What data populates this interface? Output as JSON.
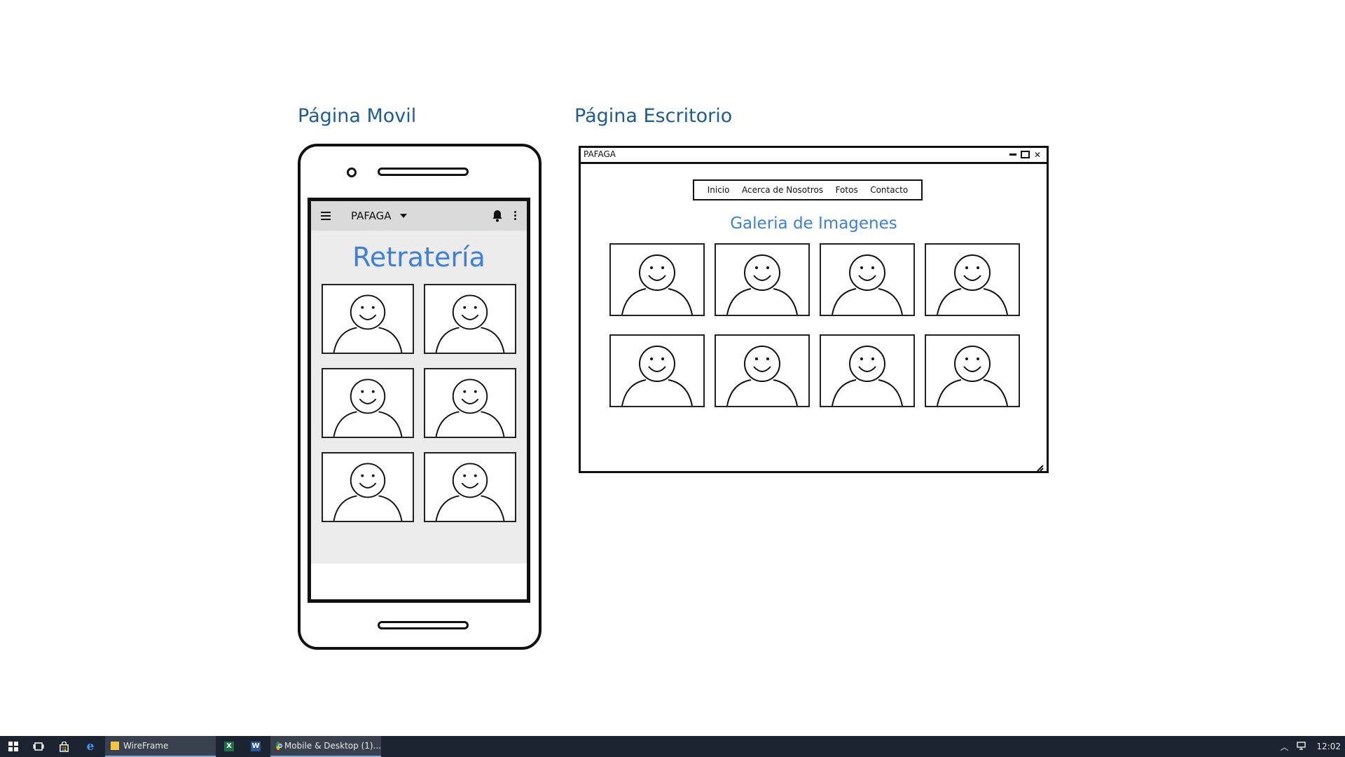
{
  "mobile": {
    "section_title": "Página Movil",
    "app_title": "PAFAGA",
    "heading": "Retratería",
    "icons": [
      "hamburger-icon",
      "dropdown-arrow-icon",
      "bell-icon",
      "more-vert-icon"
    ],
    "photo_count": 6
  },
  "desktop": {
    "section_title": "Página Escritorio",
    "window_title": "PAFAGA",
    "nav": [
      "Inicio",
      "Acerca de Nosotros",
      "Fotos",
      "Contacto"
    ],
    "heading": "Galeria de Imagenes",
    "photo_count": 8
  },
  "taskbar": {
    "items": [
      {
        "name": "start-icon",
        "label": ""
      },
      {
        "name": "task-view-icon",
        "label": ""
      },
      {
        "name": "store-icon",
        "label": ""
      },
      {
        "name": "edge-icon",
        "label": ""
      },
      {
        "name": "file-explorer-wireframe",
        "label": "WireFrame"
      },
      {
        "name": "excel-icon",
        "label": ""
      },
      {
        "name": "word-icon",
        "label": ""
      },
      {
        "name": "chrome-mobile-desktop",
        "label": "Mobile & Desktop (1)..."
      }
    ],
    "clock": "12:02"
  },
  "colors": {
    "title_blue": "#1f5c96",
    "heading_blue": "#3d7fd9",
    "taskbar": "#1c2331"
  }
}
